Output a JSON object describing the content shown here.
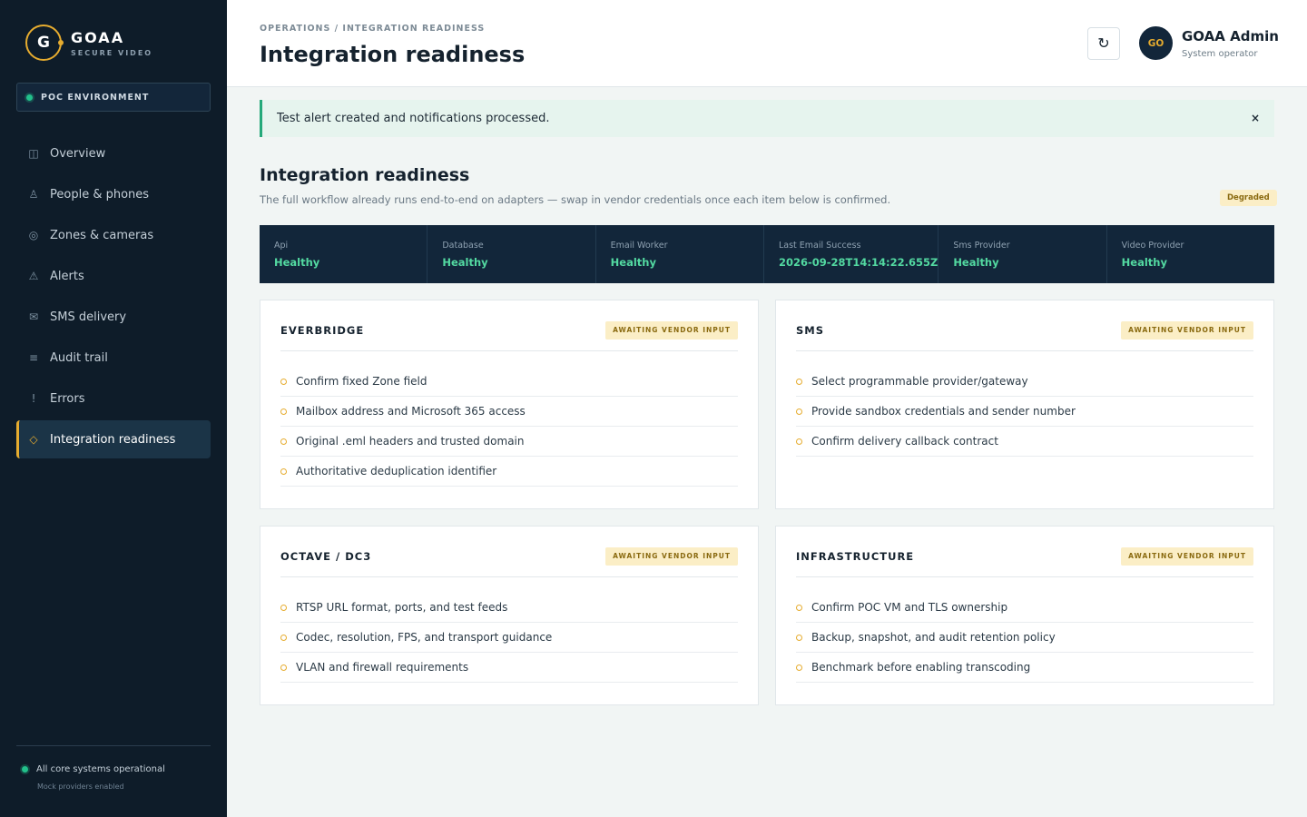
{
  "brand": {
    "name": "GOAA",
    "subtitle": "SECURE VIDEO",
    "logo_letter": "G"
  },
  "environment": {
    "label": "POC ENVIRONMENT"
  },
  "nav": [
    {
      "label": "Overview",
      "icon": "layout-icon"
    },
    {
      "label": "People & phones",
      "icon": "person-icon"
    },
    {
      "label": "Zones & cameras",
      "icon": "camera-icon"
    },
    {
      "label": "Alerts",
      "icon": "warning-icon"
    },
    {
      "label": "SMS delivery",
      "icon": "mail-icon"
    },
    {
      "label": "Audit trail",
      "icon": "list-icon"
    },
    {
      "label": "Errors",
      "icon": "exclamation-icon"
    },
    {
      "label": "Integration readiness",
      "icon": "diamond-icon",
      "active": true
    }
  ],
  "sidebar_footer": {
    "status": "All core systems operational",
    "note": "Mock providers enabled"
  },
  "header": {
    "breadcrumb": "OPERATIONS / INTEGRATION READINESS",
    "title": "Integration readiness",
    "user": {
      "initials": "GO",
      "name": "GOAA Admin",
      "role": "System operator"
    }
  },
  "alert": {
    "message": "Test alert created and notifications processed.",
    "close": "×"
  },
  "section": {
    "title": "Integration readiness",
    "description": "The full workflow already runs end-to-end on adapters — swap in vendor credentials once each item below is confirmed.",
    "status_badge": "Degraded"
  },
  "status": [
    {
      "key": "Api",
      "value": "Healthy"
    },
    {
      "key": "Database",
      "value": "Healthy"
    },
    {
      "key": "Email Worker",
      "value": "Healthy"
    },
    {
      "key": "Last Email Success",
      "value": "2026-09-28T14:14:22.655Z"
    },
    {
      "key": "Sms Provider",
      "value": "Healthy"
    },
    {
      "key": "Video Provider",
      "value": "Healthy"
    }
  ],
  "cards": [
    {
      "title": "EVERBRIDGE",
      "badge": "AWAITING VENDOR INPUT",
      "items": [
        "Confirm fixed Zone field",
        "Mailbox address and Microsoft 365 access",
        "Original .eml headers and trusted domain",
        "Authoritative deduplication identifier"
      ]
    },
    {
      "title": "SMS",
      "badge": "AWAITING VENDOR INPUT",
      "items": [
        "Select programmable provider/gateway",
        "Provide sandbox credentials and sender number",
        "Confirm delivery callback contract"
      ]
    },
    {
      "title": "OCTAVE / DC3",
      "badge": "AWAITING VENDOR INPUT",
      "items": [
        "RTSP URL format, ports, and test feeds",
        "Codec, resolution, FPS, and transport guidance",
        "VLAN and firewall requirements"
      ]
    },
    {
      "title": "INFRASTRUCTURE",
      "badge": "AWAITING VENDOR INPUT",
      "items": [
        "Confirm POC VM and TLS ownership",
        "Backup, snapshot, and audit retention policy",
        "Benchmark before enabling transcoding"
      ]
    }
  ],
  "colors": {
    "accent": "#e6ac2f",
    "sidebar": "#0e1c29",
    "healthy": "#53d9a1",
    "success_bg": "#e6f4ee",
    "badge_bg": "#fbeec6"
  }
}
